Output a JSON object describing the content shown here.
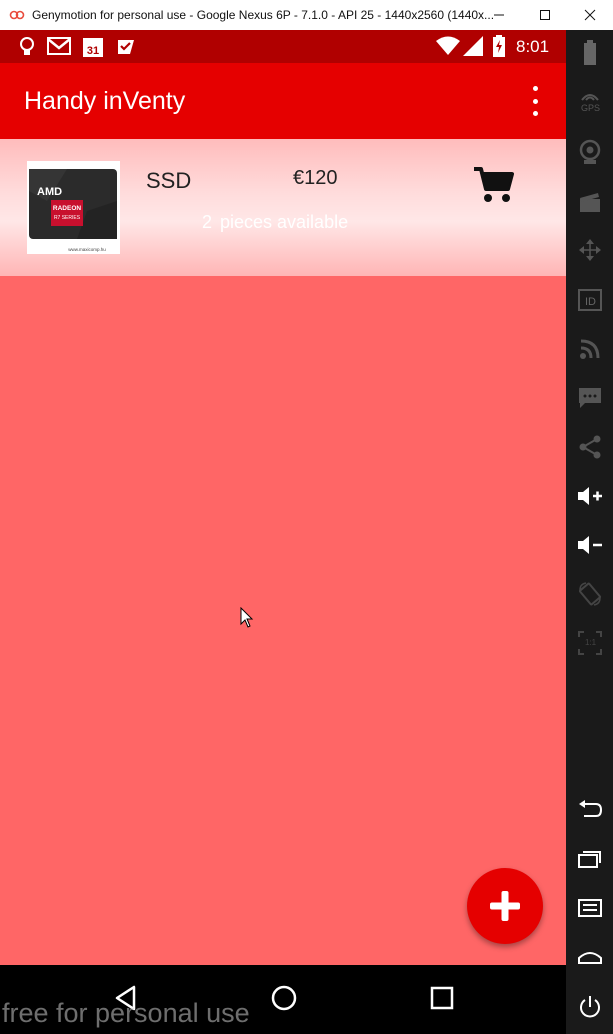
{
  "window": {
    "title": "Genymotion for personal use - Google Nexus 6P - 7.1.0 - API 25 - 1440x2560 (1440x..."
  },
  "statusbar": {
    "time": "8:01",
    "calendar_day": "31"
  },
  "app": {
    "title": "Handy inVenty"
  },
  "items": [
    {
      "name": "SSD",
      "price": "€120",
      "quantity": "2",
      "quantity_label": "pieces available",
      "thumbnail_brand": "AMD",
      "thumbnail_line": "RADEON",
      "thumbnail_sub": "R7 SERIES",
      "thumbnail_footer": "www.maxicomp.hu"
    }
  ],
  "sidebar": {
    "gps_label": "GPS",
    "id_label": "ID",
    "ratio_label": "1:1"
  },
  "watermark": "free for personal use",
  "colors": {
    "status_bar": "#b00000",
    "app_bar": "#e50000",
    "content_bg": "#ff6666",
    "fab": "#e50000"
  }
}
